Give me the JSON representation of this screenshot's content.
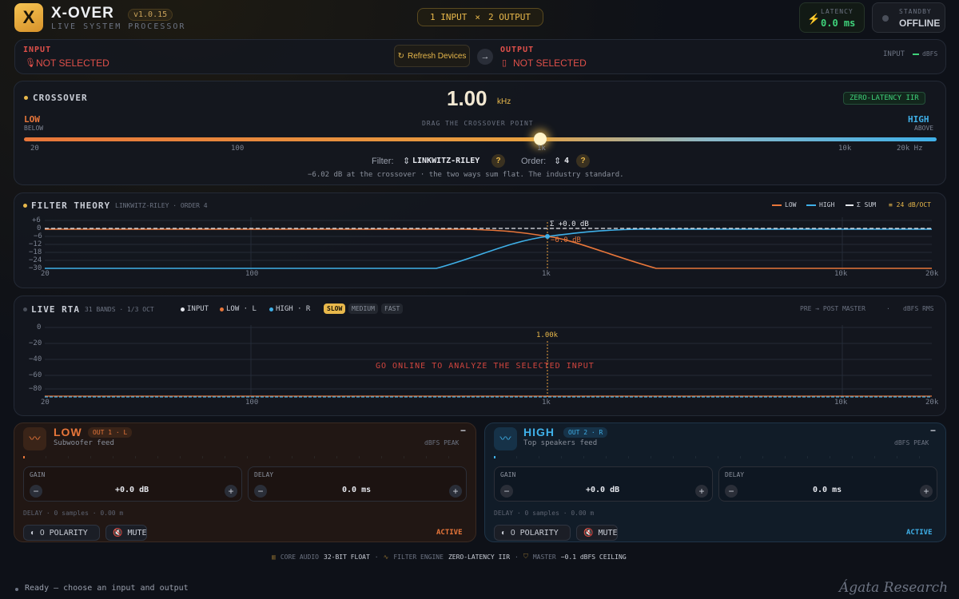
{
  "header": {
    "logo_letter": "X",
    "title": "X-OVER",
    "version": "v1.0.15",
    "subtitle": "LIVE SYSTEM PROCESSOR",
    "routing": {
      "inputs": "1 INPUT",
      "sep": "×",
      "outputs": "2 OUTPUT"
    },
    "latency": {
      "label": "LATENCY",
      "value": "0.0 ms"
    },
    "standby": {
      "label": "STANDBY",
      "value": "OFFLINE"
    }
  },
  "io": {
    "input_label": "INPUT",
    "input_value": "NOT SELECTED",
    "refresh_label": "Refresh Devices",
    "output_label": "OUTPUT",
    "output_value": "NOT SELECTED",
    "meter_label": "INPUT",
    "meter_unit": "dBFS"
  },
  "crossover": {
    "title": "CROSSOVER",
    "value": "1.00",
    "unit": "kHz",
    "badge": "ZERO-LATENCY IIR",
    "low_label": "LOW",
    "low_sub": "BELOW",
    "high_label": "HIGH",
    "high_sub": "ABOVE",
    "drag_hint": "DRAG THE CROSSOVER POINT",
    "ticks": [
      "20",
      "100",
      "1k",
      "10k",
      "20k Hz"
    ],
    "filter_label": "Filter:",
    "filter_value": "LINKWITZ-RILEY",
    "order_label": "Order:",
    "order_value": "4",
    "help": "?",
    "note": "−6.02 dB at the crossover · the two ways sum flat. The industry standard."
  },
  "theory": {
    "title": "FILTER THEORY",
    "subtitle": "LINKWITZ-RILEY · ORDER 4",
    "legend": {
      "low": "LOW",
      "high": "HIGH",
      "sum": "Σ SUM",
      "slope": "24 dB/OCT"
    },
    "y_ticks": [
      "+6",
      "0",
      "−6",
      "−12",
      "−18",
      "−24",
      "−30"
    ],
    "x_ticks": [
      "20",
      "100",
      "1k",
      "10k",
      "20k"
    ],
    "sum_annotation": "Σ +0.0 dB",
    "xover_annotation": "−6.0 dB"
  },
  "rta": {
    "title": "LIVE RTA",
    "bands": "31 BANDS · 1/3 OCT",
    "legend_input": "INPUT",
    "legend_low": "LOW · L",
    "legend_high": "HIGH · R",
    "speeds": [
      "SLOW",
      "MEDIUM",
      "FAST"
    ],
    "active_speed": "SLOW",
    "route_label": "PRE → POST MASTER",
    "dot": "·",
    "units": "dBFS RMS",
    "y_ticks": [
      "0",
      "−20",
      "−40",
      "−60",
      "−80"
    ],
    "x_ticks": [
      "20",
      "100",
      "1k",
      "10k",
      "20k"
    ],
    "marker": "1.00k",
    "message": "GO ONLINE TO ANALYZE THE SELECTED INPUT"
  },
  "low_channel": {
    "name": "LOW",
    "route": "OUT 1 · L",
    "feed": "Subwoofer feed",
    "meter_label": "dBFS PEAK",
    "meter_value": "−",
    "gain_label": "GAIN",
    "gain_value": "+0.0 dB",
    "delay_label": "DELAY",
    "delay_value": "0.0 ms",
    "delay_info": "DELAY · 0 samples · 0.00 m",
    "polarity_icon": "◐",
    "polarity_value": "0",
    "polarity_label": "POLARITY",
    "mute_label": "MUTE",
    "status": "ACTIVE"
  },
  "high_channel": {
    "name": "HIGH",
    "route": "OUT 2 · R",
    "feed": "Top speakers feed",
    "meter_label": "dBFS PEAK",
    "meter_value": "−",
    "gain_label": "GAIN",
    "gain_value": "+0.0 dB",
    "delay_label": "DELAY",
    "delay_value": "0.0 ms",
    "delay_info": "DELAY · 0 samples · 0.00 m",
    "polarity_icon": "◐",
    "polarity_value": "0",
    "polarity_label": "POLARITY",
    "mute_label": "MUTE",
    "status": "ACTIVE"
  },
  "footer": {
    "core_label": "CORE AUDIO",
    "core_value": "32-BIT FLOAT",
    "engine_label": "FILTER ENGINE",
    "engine_value": "ZERO-LATENCY IIR",
    "master_label": "MASTER",
    "master_value": "−0.1 dBFS CEILING",
    "sep": "·",
    "status": "Ready — choose an input and output",
    "signature": "Ágata Research"
  },
  "colors": {
    "accent": "#e8b84b",
    "low": "#e8763a",
    "high": "#3fb0e8",
    "error": "#e0504a",
    "ok": "#3fd27a"
  }
}
